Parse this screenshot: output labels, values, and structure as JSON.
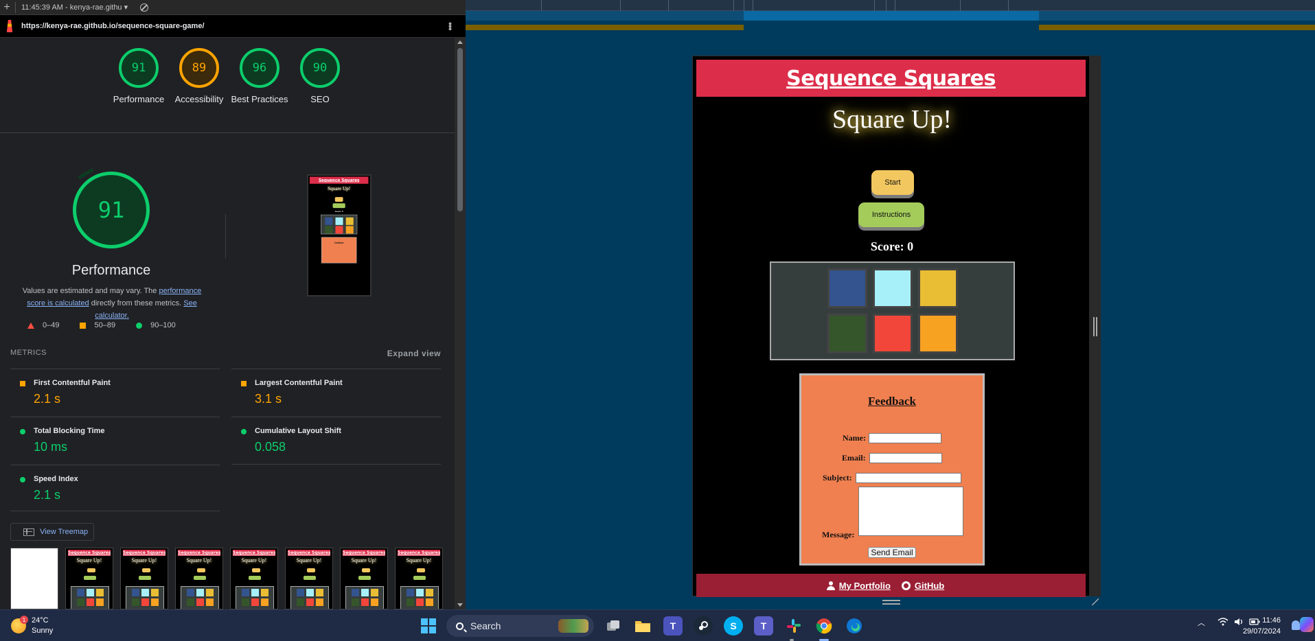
{
  "devtools": {
    "top_tab": "11:45:39 AM - kenya-rae.githu ▾",
    "url": "https://kenya-rae.github.io/sequence-square-game/"
  },
  "lighthouse": {
    "scores": [
      {
        "value": "91",
        "label": "Performance",
        "color": "green"
      },
      {
        "value": "89",
        "label": "Accessibility",
        "color": "orange"
      },
      {
        "value": "96",
        "label": "Best Practices",
        "color": "green"
      },
      {
        "value": "90",
        "label": "SEO",
        "color": "green"
      }
    ],
    "perf_score": "91",
    "perf_title": "Performance",
    "desc_prefix": "Values are estimated and may vary. The ",
    "desc_link1": "performance score is calculated",
    "desc_mid": " directly from these metrics. ",
    "desc_link2": "See calculator.",
    "legend": [
      "0–49",
      "50–89",
      "90–100"
    ],
    "metrics_label": "METRICS",
    "expand_label": "Expand view",
    "metrics": [
      {
        "name": "First Contentful Paint",
        "value": "2.1 s",
        "status": "orange"
      },
      {
        "name": "Largest Contentful Paint",
        "value": "3.1 s",
        "status": "orange"
      },
      {
        "name": "Total Blocking Time",
        "value": "10 ms",
        "status": "green"
      },
      {
        "name": "Cumulative Layout Shift",
        "value": "0.058",
        "status": "green"
      },
      {
        "name": "Speed Index",
        "value": "2.1 s",
        "status": "green"
      }
    ],
    "treemap_label": "View Treemap",
    "colors": {
      "green": "#0cce6b",
      "orange": "#ffa400",
      "red": "#ff4e42"
    }
  },
  "site": {
    "title": "Sequence Squares",
    "headline": "Square Up!",
    "start_label": "Start",
    "instructions_label": "Instructions",
    "score_text": "Score: 0",
    "tiles": [
      "#33548e",
      "#a7f0fa",
      "#eabe34",
      "#35562a",
      "#f3463a",
      "#f8a222"
    ],
    "feedback_title": "Feedback",
    "name_label": "Name:",
    "email_label": "Email:",
    "subject_label": "Subject:",
    "message_label": "Message:",
    "send_label": "Send Email",
    "portfolio_label": "My Portfolio",
    "github_label": "GitHub"
  },
  "taskbar": {
    "weather_temp": "24°C",
    "weather_desc": "Sunny",
    "weather_badge": "1",
    "search_label": "Search",
    "time": "11:46",
    "date": "29/07/2024"
  }
}
